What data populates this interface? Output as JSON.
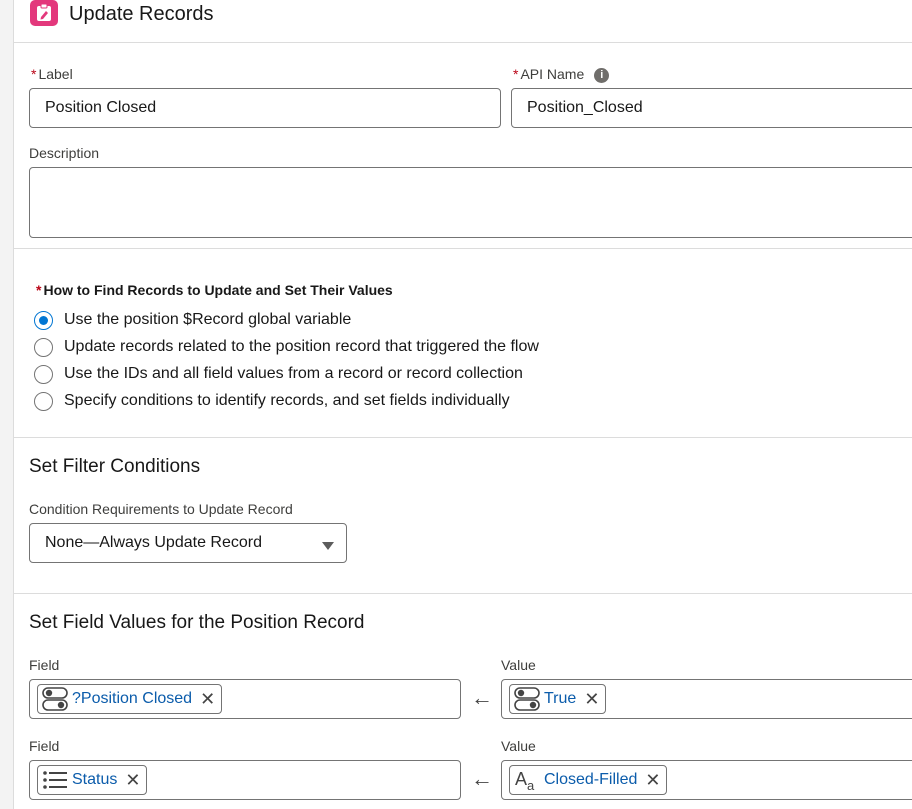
{
  "header": {
    "title": "Update Records"
  },
  "fields": {
    "label": {
      "label": "Label",
      "required_mark": "*",
      "value": "Position Closed"
    },
    "api_name": {
      "label": "API Name",
      "required_mark": "*",
      "value": "Position_Closed",
      "info_glyph": "i"
    },
    "description": {
      "label": "Description",
      "value": ""
    }
  },
  "how_to_find": {
    "required_mark": "*",
    "label": "How to Find Records to Update and Set Their Values",
    "options": [
      {
        "label": "Use the position $Record global variable",
        "selected": true
      },
      {
        "label": "Update records related to the position record that triggered the flow",
        "selected": false
      },
      {
        "label": "Use the IDs and all field values from a record or record collection",
        "selected": false
      },
      {
        "label": "Specify conditions to identify records, and set fields individually",
        "selected": false
      }
    ]
  },
  "filter": {
    "title": "Set Filter Conditions",
    "condition_label": "Condition Requirements to Update Record",
    "condition_value": "None—Always Update Record"
  },
  "field_values": {
    "title": "Set Field Values for the Position Record",
    "rows": [
      {
        "field_label": "Field",
        "field_value": "?Position Closed",
        "field_icon": "toggle-icon",
        "value_label": "Value",
        "value_value": "True",
        "value_icon": "toggle-icon",
        "remove_glyph": "✕",
        "arrow_glyph": "←"
      },
      {
        "field_label": "Field",
        "field_value": "Status",
        "field_icon": "picklist-icon",
        "value_label": "Value",
        "value_value": "Closed-Filled",
        "value_icon": "text-icon",
        "remove_glyph": "✕",
        "arrow_glyph": "←"
      }
    ]
  },
  "colors": {
    "accent": "#0176d3",
    "required": "#ba0517",
    "header_icon": "#e3387c",
    "pill_text": "#0b5cab"
  }
}
